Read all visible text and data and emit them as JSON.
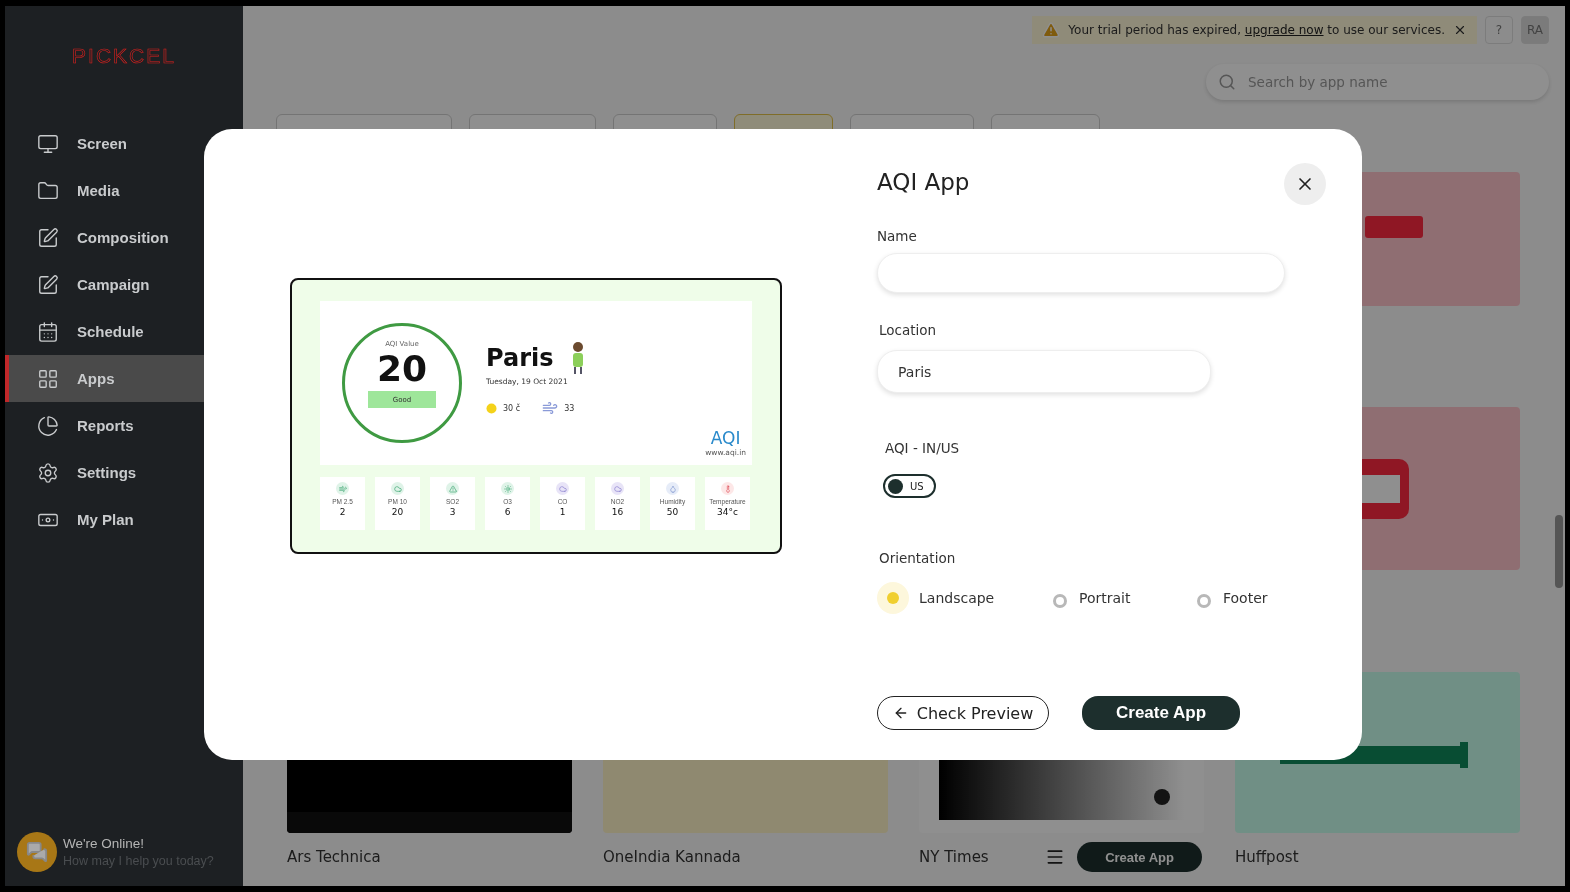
{
  "sidebar": {
    "logo": "PICKCEL",
    "items": [
      {
        "label": "Screen",
        "selected": false
      },
      {
        "label": "Media",
        "selected": false
      },
      {
        "label": "Composition",
        "selected": false
      },
      {
        "label": "Campaign",
        "selected": false
      },
      {
        "label": "Schedule",
        "selected": false
      },
      {
        "label": "Apps",
        "selected": true
      },
      {
        "label": "Reports",
        "selected": false
      },
      {
        "label": "Settings",
        "selected": false
      },
      {
        "label": "My Plan",
        "selected": false
      }
    ]
  },
  "chat": {
    "title": "We're Online!",
    "subtitle": "How may I help you today?"
  },
  "banner": {
    "before": "Your trial period has expired, ",
    "link": "upgrade now",
    "after": " to use our services."
  },
  "help": "?",
  "avatar": "RA",
  "search": {
    "placeholder": "Search by app name"
  },
  "category_tabs": [
    {
      "selected": false
    },
    {
      "selected": false
    },
    {
      "selected": false
    },
    {
      "selected": true
    },
    {
      "selected": false
    },
    {
      "selected": false
    }
  ],
  "apps": [
    {
      "label": "Ars Technica"
    },
    {
      "label": "OneIndia Kannada"
    },
    {
      "label": "NY Times",
      "action": "Create App"
    },
    {
      "label": "Huffpost"
    }
  ],
  "modal": {
    "title": "AQI App",
    "name": {
      "label": "Name"
    },
    "location": {
      "label": "Location",
      "value": "Paris"
    },
    "standard": {
      "label": "AQI - IN/US",
      "text": "US"
    },
    "orientation": {
      "label": "Orientation",
      "options": [
        {
          "label": "Landscape",
          "selected": true
        },
        {
          "label": "Portrait",
          "selected": false
        },
        {
          "label": "Footer",
          "selected": false
        }
      ]
    },
    "buttons": {
      "preview": "Check Preview",
      "create": "Create App"
    },
    "preview": {
      "aqi_label": "AQI Value",
      "aqi": "20",
      "status": "Good",
      "city": "Paris",
      "date": "Tuesday, 19 Oct 2021",
      "temp": "30 č",
      "wind": "33",
      "logo": "AQI",
      "site": "www.aqi.in",
      "pollutants": [
        {
          "name": "PM 2.5",
          "value": "2"
        },
        {
          "name": "PM 10",
          "value": "20"
        },
        {
          "name": "SO2",
          "value": "3"
        },
        {
          "name": "O3",
          "value": "6"
        },
        {
          "name": "CO",
          "value": "1"
        },
        {
          "name": "NO2",
          "value": "16"
        },
        {
          "name": "Humidity",
          "value": "50"
        },
        {
          "name": "Temperature",
          "value": "34°c"
        }
      ]
    }
  }
}
